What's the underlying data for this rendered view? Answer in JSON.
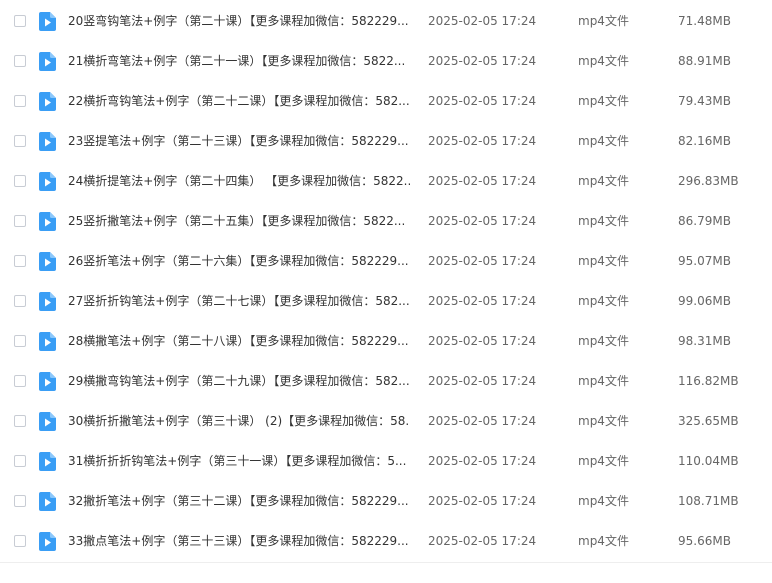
{
  "files": [
    {
      "name": "20竖弯钩笔法+例字（第二十课）【更多课程加微信：582229...",
      "date": "2025-02-05 17:24",
      "type": "mp4文件",
      "size": "71.48MB"
    },
    {
      "name": "21横折弯笔法+例字（第二十一课）【更多课程加微信：5822...",
      "date": "2025-02-05 17:24",
      "type": "mp4文件",
      "size": "88.91MB"
    },
    {
      "name": "22横折弯钩笔法+例字（第二十二课）【更多课程加微信：582...",
      "date": "2025-02-05 17:24",
      "type": "mp4文件",
      "size": "79.43MB"
    },
    {
      "name": "23竖提笔法+例字（第二十三课）【更多课程加微信：582229...",
      "date": "2025-02-05 17:24",
      "type": "mp4文件",
      "size": "82.16MB"
    },
    {
      "name": "24横折提笔法+例字（第二十四集） 【更多课程加微信：5822...",
      "date": "2025-02-05 17:24",
      "type": "mp4文件",
      "size": "296.83MB"
    },
    {
      "name": "25竖折撇笔法+例字（第二十五集）【更多课程加微信：5822...",
      "date": "2025-02-05 17:24",
      "type": "mp4文件",
      "size": "86.79MB"
    },
    {
      "name": "26竖折笔法+例字（第二十六集）【更多课程加微信：582229...",
      "date": "2025-02-05 17:24",
      "type": "mp4文件",
      "size": "95.07MB"
    },
    {
      "name": "27竖折折钩笔法+例字（第二十七课）【更多课程加微信：582...",
      "date": "2025-02-05 17:24",
      "type": "mp4文件",
      "size": "99.06MB"
    },
    {
      "name": "28横撇笔法+例字（第二十八课）【更多课程加微信：582229...",
      "date": "2025-02-05 17:24",
      "type": "mp4文件",
      "size": "98.31MB"
    },
    {
      "name": "29横撇弯钩笔法+例字（第二十九课）【更多课程加微信：582...",
      "date": "2025-02-05 17:24",
      "type": "mp4文件",
      "size": "116.82MB"
    },
    {
      "name": "30横折折撇笔法+例字（第三十课） (2)【更多课程加微信：58...",
      "date": "2025-02-05 17:24",
      "type": "mp4文件",
      "size": "325.65MB"
    },
    {
      "name": "31横折折折钩笔法+例字（第三十一课）【更多课程加微信：5...",
      "date": "2025-02-05 17:24",
      "type": "mp4文件",
      "size": "110.04MB"
    },
    {
      "name": "32撇折笔法+例字（第三十二课）【更多课程加微信：582229...",
      "date": "2025-02-05 17:24",
      "type": "mp4文件",
      "size": "108.71MB"
    },
    {
      "name": "33撇点笔法+例字（第三十三课）【更多课程加微信：582229...",
      "date": "2025-02-05 17:24",
      "type": "mp4文件",
      "size": "95.66MB"
    }
  ],
  "colors": {
    "icon_blue": "#3a9ef5",
    "text": "#333333",
    "meta_text": "#666666"
  },
  "icons": {
    "file": "video-file-icon",
    "checkbox": "checkbox"
  }
}
